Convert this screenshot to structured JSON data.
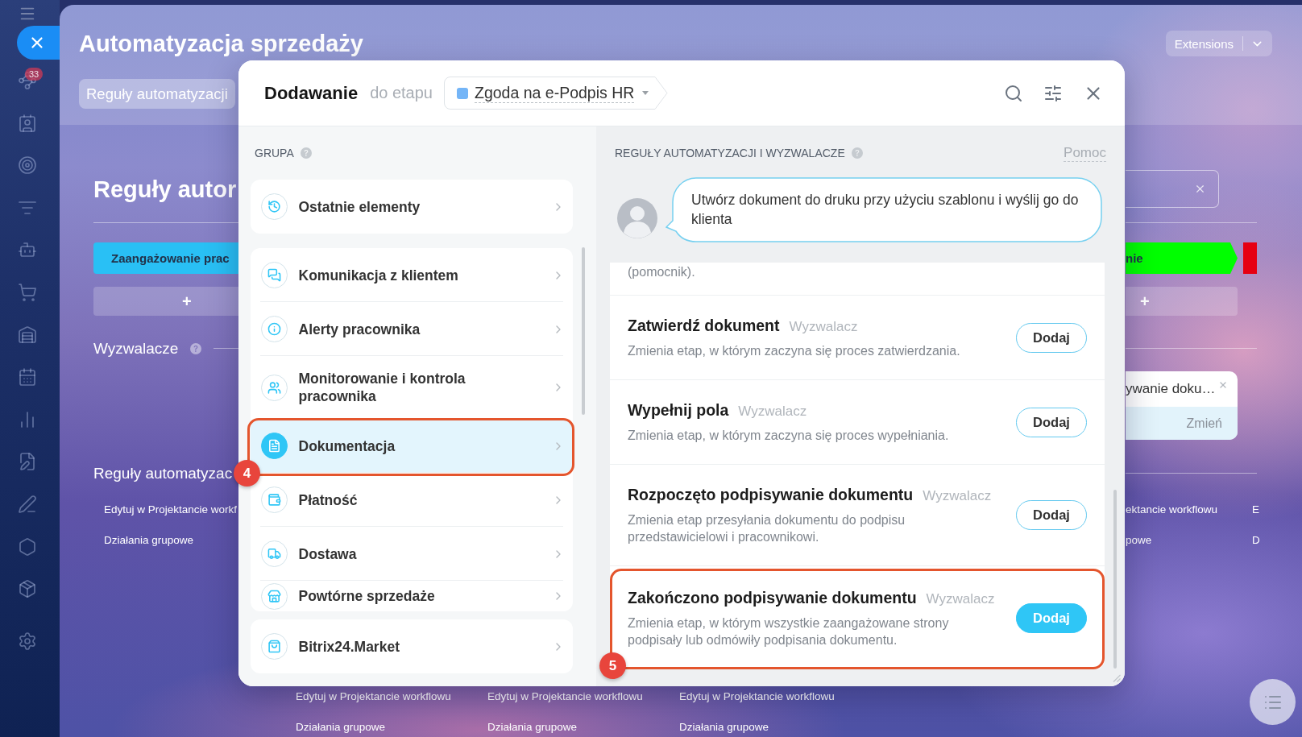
{
  "sidebar": {
    "badge": "33"
  },
  "page": {
    "title": "Automatyzacja sprzedaży",
    "tabs": [
      {
        "label": "Reguły automatyzacji",
        "selected": true
      }
    ],
    "extensions_button": "Extensions"
  },
  "board": {
    "left_column": {
      "heading": "Reguły autor",
      "stage": {
        "label": "Zaangażowanie prac",
        "color": "#29c0f5"
      },
      "add_button": "+",
      "triggers_heading": "Wyzwalacze",
      "rules_heading": "Reguły automatyzac",
      "links": [
        "Edytuj w Projektancie workf",
        "Działania grupowe"
      ]
    },
    "right_column": {
      "stages": [
        {
          "label": "nie",
          "color": "#00ff00"
        },
        {
          "color": "#e60012"
        }
      ],
      "add_button": "+",
      "trigger_card": {
        "title": "ywanie doku…",
        "action": "Zmień"
      },
      "links": [
        "ektancie workflowu",
        "powe"
      ],
      "next_column_links": [
        "E",
        "D"
      ]
    },
    "bottom_columns": [
      {
        "links": [
          "Edytuj w Projektancie workflowu",
          "Działania grupowe"
        ]
      },
      {
        "links": [
          "Edytuj w Projektancie workflowu",
          "Działania grupowe"
        ]
      },
      {
        "links": [
          "Edytuj w Projektancie workflowu",
          "Działania grupowe"
        ]
      }
    ]
  },
  "dialog": {
    "title": "Dodawanie",
    "subtitle": "do etapu",
    "stage": "Zgoda na e-Podpis HR",
    "groups_heading": "GRUPA",
    "group_sections": [
      {
        "items": [
          {
            "label": "Ostatnie elementy",
            "selected": false
          }
        ]
      },
      {
        "items": [
          {
            "label": "Komunikacja z klientem",
            "selected": false
          },
          {
            "label": "Alerty pracownika",
            "selected": false
          },
          {
            "label": "Monitorowanie i kontrola pracownika",
            "selected": false
          },
          {
            "label": "Dokumentacja",
            "selected": true,
            "callout": "4"
          },
          {
            "label": "Płatność",
            "selected": false
          },
          {
            "label": "Dostawa",
            "selected": false
          },
          {
            "label": "Powtórne sprzedaże",
            "selected": false
          }
        ]
      },
      {
        "items": [
          {
            "label": "Bitrix24.Market",
            "selected": false
          }
        ]
      }
    ],
    "rules_heading": "REGUŁY AUTOMATYZACJI I WYZWALACZE",
    "help_link": "Pomoc",
    "assistant_message": "Utwórz dokument do druku przy użyciu szablonu i wyślij go do klienta",
    "rules": [
      {
        "description": "(pomocnik)."
      },
      {
        "title": "Zatwierdź dokument",
        "tag": "Wyzwalacz",
        "description": "Zmienia etap, w którym zaczyna się proces zatwierdzania.",
        "button": "Dodaj",
        "highlighted": false
      },
      {
        "title": "Wypełnij pola",
        "tag": "Wyzwalacz",
        "description": "Zmienia etap, w którym zaczyna się proces wypełniania.",
        "button": "Dodaj",
        "highlighted": false
      },
      {
        "title": "Rozpoczęto podpisywanie dokumentu",
        "tag": "Wyzwalacz",
        "description": "Zmienia etap przesyłania dokumentu do podpisu przedstawicielowi i pracownikowi.",
        "button": "Dodaj",
        "highlighted": false
      },
      {
        "title": "Zakończono podpisywanie dokumentu",
        "tag": "Wyzwalacz",
        "description": "Zmienia etap, w którym wszystkie zaangażowane strony podpisały lub odmówiły podpisania dokumentu.",
        "button": "Dodaj",
        "highlighted": true,
        "callout": "5"
      }
    ]
  }
}
